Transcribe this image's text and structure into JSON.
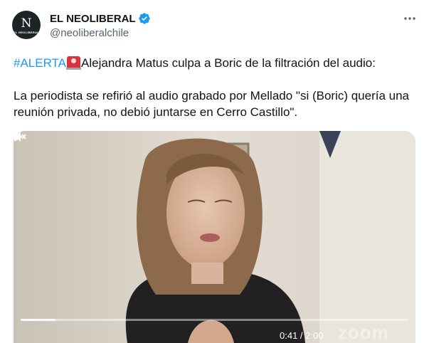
{
  "author": {
    "display_name": "EL NEOLIBERAL",
    "handle": "@neoliberalchile",
    "avatar_letter": "N",
    "avatar_caption": "EL NEOLIBERAL",
    "verified_color": "#1d9bf0"
  },
  "tweet": {
    "hashtag": "#ALERTA",
    "emoji": "police-light-emoji",
    "line1_rest": "Alejandra Matus culpa a Boric de la filtración del audio:",
    "paragraph2": "La periodista se refirió al audio grabado por Mellado \"si (Boric) quería una reunión privada, no debió juntarse en Cerro Castillo\".",
    "link_color": "#1d9bf0"
  },
  "video": {
    "progress": 0.09,
    "time": "0:41 / 2:00",
    "watermark": "zoom"
  }
}
